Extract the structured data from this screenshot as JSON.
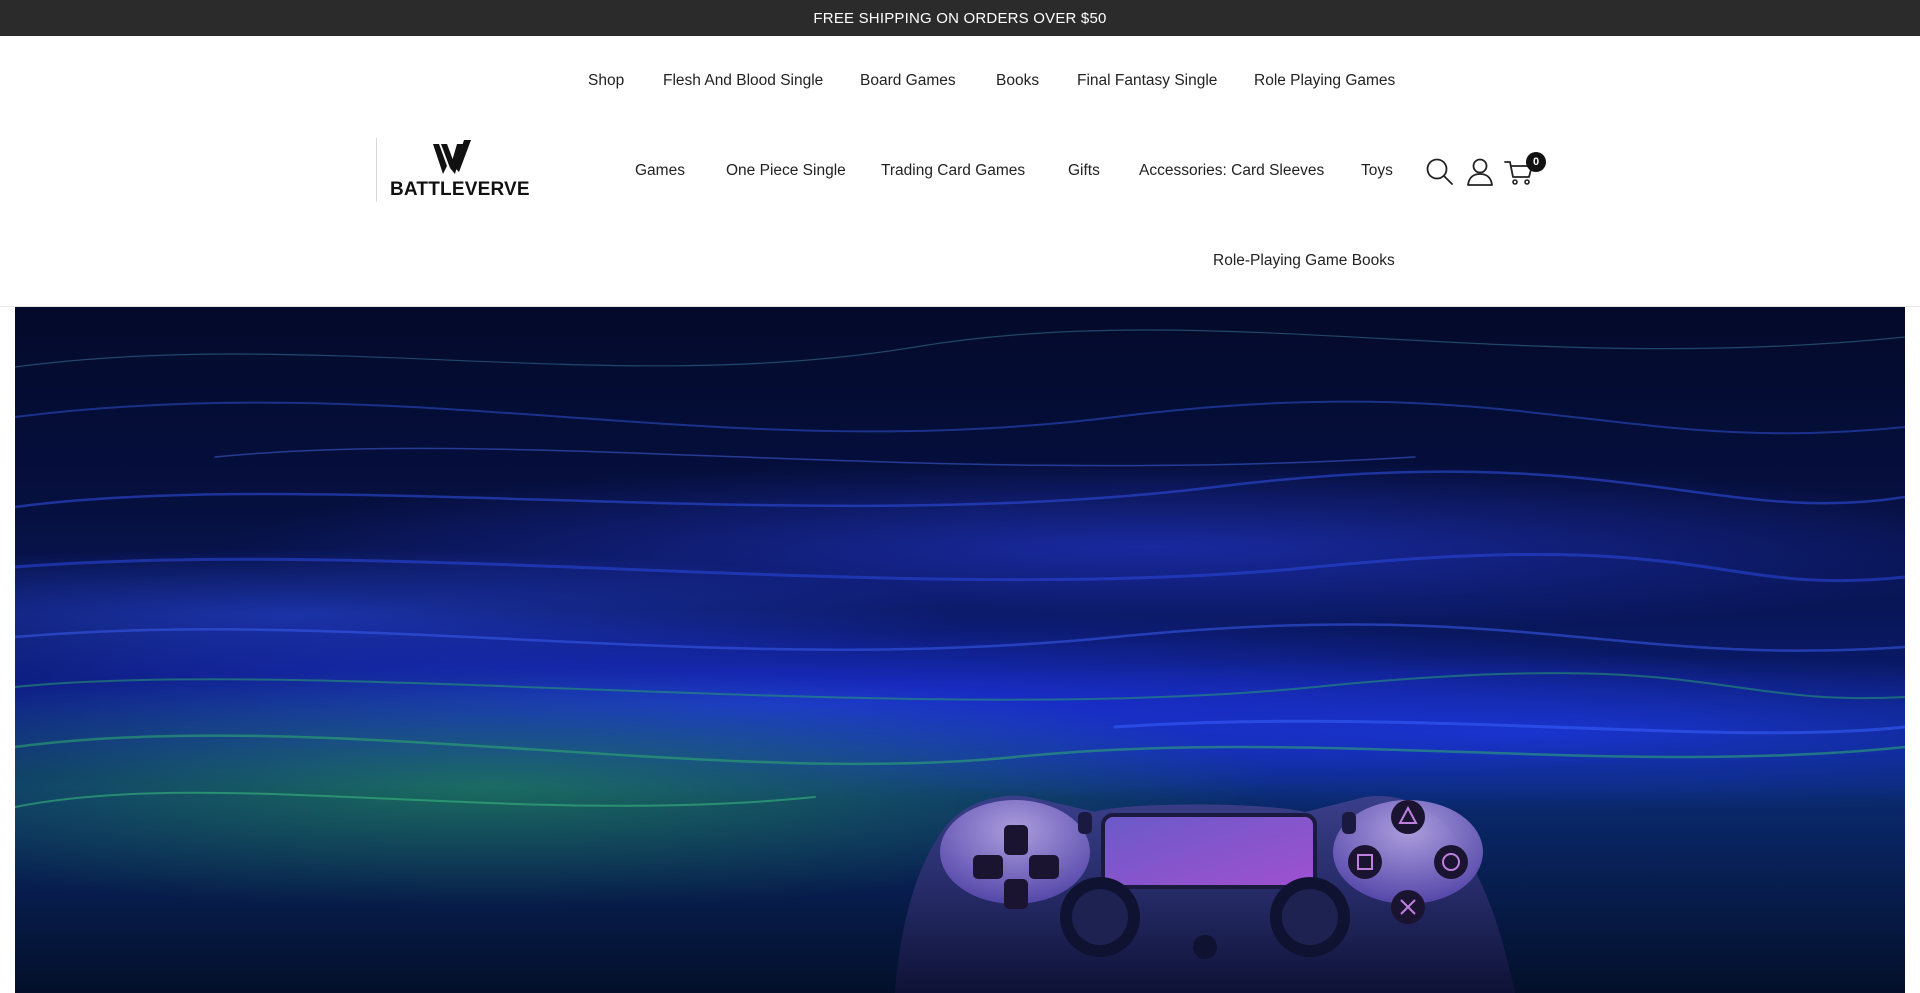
{
  "announcement": {
    "text": "FREE SHIPPING ON ORDERS OVER $50"
  },
  "brand": {
    "name": "BATTLEVERVE"
  },
  "nav": {
    "row1": [
      "Shop",
      "Flesh And Blood Single",
      "Board Games",
      "Books",
      "Final Fantasy Single",
      "Role Playing Games"
    ],
    "row2": [
      "Games",
      "One Piece Single",
      "Trading Card Games",
      "Gifts",
      "Accessories: Card Sleeves",
      "Toys"
    ],
    "row3": [
      "Role-Playing Game Books"
    ]
  },
  "header_icons": {
    "search": "search-icon",
    "account": "user-icon",
    "cart": "cart-icon"
  },
  "cart": {
    "count": "0"
  },
  "hero": {
    "image": "game-controller-light-streaks"
  },
  "colors": {
    "announce_bg": "#2b2b2b",
    "text": "#222222",
    "badge": "#111111"
  }
}
